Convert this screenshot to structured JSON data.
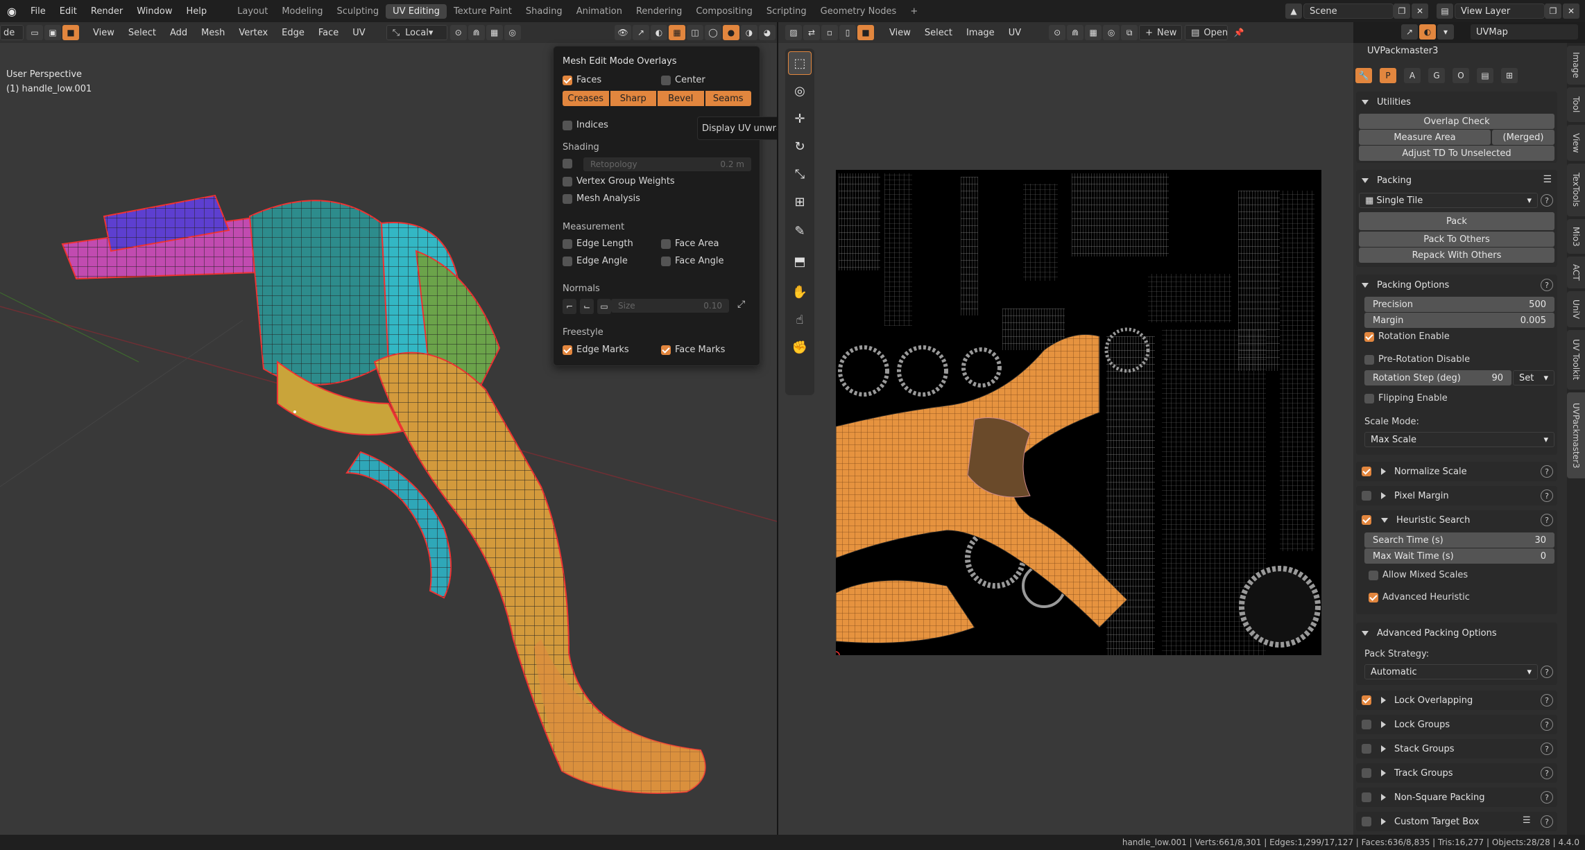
{
  "topbar": {
    "menus": [
      "File",
      "Edit",
      "Render",
      "Window",
      "Help"
    ],
    "workspaces": [
      "Layout",
      "Modeling",
      "Sculpting",
      "UV Editing",
      "Texture Paint",
      "Shading",
      "Animation",
      "Rendering",
      "Compositing",
      "Scripting",
      "Geometry Nodes"
    ],
    "active_workspace": "UV Editing",
    "add_tab": "+",
    "scene": "Scene",
    "view_layer": "View Layer"
  },
  "viewport3d": {
    "mode_label": "de",
    "menus": [
      "View",
      "Select",
      "Add",
      "Mesh",
      "Vertex",
      "Edge",
      "Face",
      "UV"
    ],
    "transform_orientation": "Local",
    "perspective_label": "User Perspective",
    "object_label": "(1) handle_low.001"
  },
  "overlays_popup": {
    "title": "Mesh Edit Mode Overlays",
    "faces": "Faces",
    "center": "Center",
    "edge_buttons": [
      "Creases",
      "Sharp",
      "Bevel",
      "Seams"
    ],
    "indices": "Indices",
    "shading_title": "Shading",
    "retopology": "Retopology",
    "retopology_value": "0.2 m",
    "vertex_group_weights": "Vertex Group Weights",
    "mesh_analysis": "Mesh Analysis",
    "measurement_title": "Measurement",
    "edge_length": "Edge Length",
    "face_area": "Face Area",
    "edge_angle": "Edge Angle",
    "face_angle": "Face Angle",
    "normals_title": "Normals",
    "size_label": "Size",
    "size_value": "0.10",
    "freestyle_title": "Freestyle",
    "edge_marks": "Edge Marks",
    "face_marks": "Face Marks"
  },
  "tooltip": "Display UV unwrapping seams.",
  "uv_editor": {
    "menus": [
      "View",
      "Select",
      "Image",
      "UV"
    ],
    "new_button": "New",
    "open_button": "Open",
    "uvmap": "UVMap"
  },
  "npanel": {
    "addon_title": "UVPackmaster3",
    "utilities": {
      "title": "Utilities",
      "overlap_check": "Overlap Check",
      "measure_area": "Measure Area",
      "merged": "(Merged)",
      "adjust_td": "Adjust TD To Unselected"
    },
    "packing": {
      "title": "Packing",
      "mode": "Single Tile",
      "pack": "Pack",
      "pack_to_others": "Pack To Others",
      "repack_with_others": "Repack With Others"
    },
    "packing_options": {
      "title": "Packing Options",
      "precision_label": "Precision",
      "precision_value": "500",
      "margin_label": "Margin",
      "margin_value": "0.005",
      "rotation_enable": "Rotation Enable",
      "pre_rotation_disable": "Pre-Rotation Disable",
      "rotation_step_label": "Rotation Step (deg)",
      "rotation_step_value": "90",
      "set_label": "Set",
      "flipping_enable": "Flipping Enable",
      "scale_mode_label": "Scale Mode:",
      "scale_mode_value": "Max Scale"
    },
    "normalize_scale": "Normalize Scale",
    "pixel_margin": "Pixel Margin",
    "heuristic_search": {
      "title": "Heuristic Search",
      "search_time_label": "Search Time (s)",
      "search_time_value": "30",
      "max_wait_label": "Max Wait Time (s)",
      "max_wait_value": "0",
      "allow_mixed_scales": "Allow Mixed Scales",
      "advanced_heuristic": "Advanced Heuristic"
    },
    "advanced_packing": {
      "title": "Advanced Packing Options",
      "pack_strategy_label": "Pack Strategy:",
      "pack_strategy_value": "Automatic"
    },
    "subpanels": [
      "Lock Overlapping",
      "Lock Groups",
      "Stack Groups",
      "Track Groups",
      "Non-Square Packing",
      "Custom Target Box"
    ],
    "vertical_tabs": [
      "Image",
      "Tool",
      "View",
      "TexTools",
      "Mio3",
      "ACT",
      "UniV",
      "UV Toolkit",
      "UVPackmaster3"
    ]
  },
  "statusbar": {
    "text": "handle_low.001 | Verts:661/8,301 | Edges:1,299/17,127 | Faces:636/8,835 | Tris:16,277 | Objects:28/28 | 4.4.0"
  }
}
